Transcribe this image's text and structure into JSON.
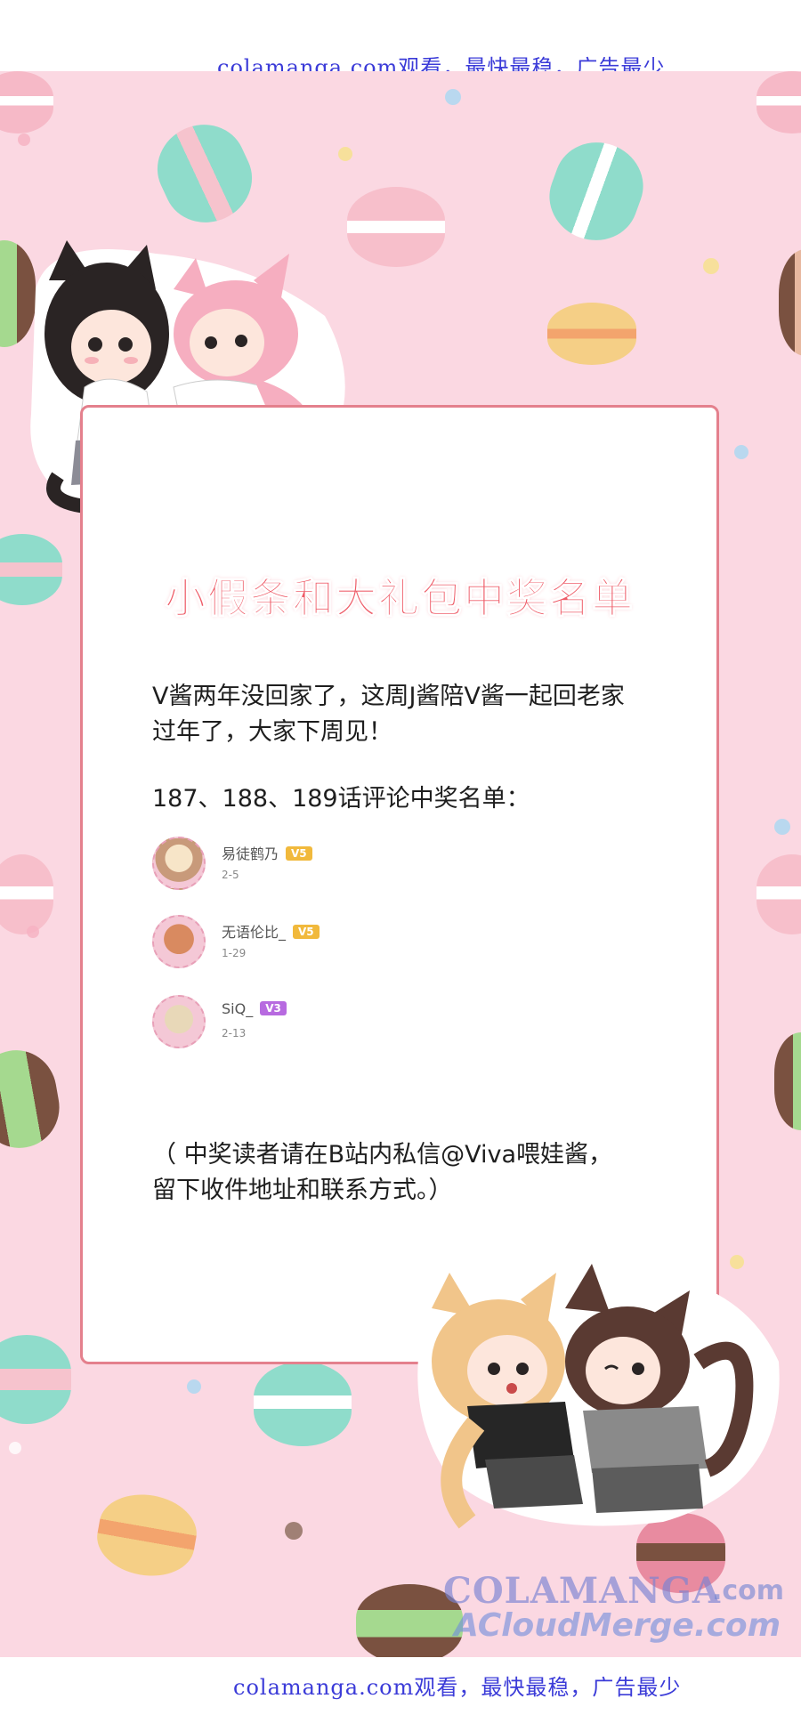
{
  "top_banner": {
    "text": "colamanga.com观看，最快最稳，广告最少"
  },
  "bottom_banner": {
    "text": "colamanga.com观看，最快最稳，广告最少"
  },
  "card": {
    "title": "小假条和大礼包中奖名单",
    "notice_line1": "V酱两年没回家了，这周J酱陪V酱一起回老家",
    "notice_line2": "过年了，大家下周见！",
    "list_heading": "187、188、189话评论中奖名单：",
    "winners": [
      {
        "name": "易徒鹤乃",
        "badge": "V5",
        "date": "2-5"
      },
      {
        "name": "无语伦比_",
        "badge": "V5",
        "date": "1-29"
      },
      {
        "name": "SiQ_",
        "badge": "V3",
        "date": "2-13"
      }
    ],
    "footer_line1": "（ 中奖读者请在B站内私信@Viva喂娃酱，",
    "footer_line2": "留下收件地址和联系方式。）"
  },
  "watermark": {
    "brand": "COLAMANGA",
    "sub": "ACloudMerge.com",
    "suffix": ".com"
  },
  "colors": {
    "background": "#fbd8e2",
    "card_border": "#e4808d",
    "title": "#ee5a66",
    "banner_link": "#3b3bd8"
  }
}
